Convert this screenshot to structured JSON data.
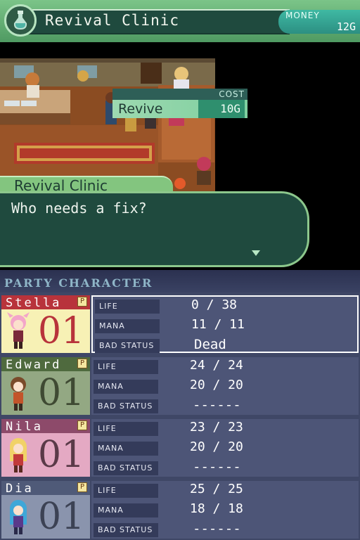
{
  "top": {
    "shop_title": "Revival Clinic",
    "money_label": "MONEY",
    "money_value": "12G",
    "cost_label": "COST",
    "service_name": "Revive",
    "service_cost": "10G",
    "dialog_speaker": "Revival Clinic",
    "dialog_text": "Who needs a fix?",
    "icon": "potion-bottle-icon"
  },
  "bottom": {
    "section_title": "PARTY CHARACTER",
    "stat_labels": {
      "life": "LIFE",
      "mana": "MANA",
      "bad_status": "BAD STATUS"
    },
    "characters": [
      {
        "name": "Stella",
        "badge": "P",
        "level": "01",
        "life": "0 / 38",
        "mana": "11 / 11",
        "bad_status": "Dead",
        "selected": true,
        "name_color": "#b8333b",
        "portrait_bg": "#f7f1b5",
        "level_color": "#b8333b"
      },
      {
        "name": "Edward",
        "badge": "P",
        "level": "01",
        "life": "24 / 24",
        "mana": "20 / 20",
        "bad_status": "------",
        "selected": false,
        "name_color": "#4f6a3e",
        "portrait_bg": "#93a883",
        "level_color": "#3f4a33"
      },
      {
        "name": "Nila",
        "badge": "P",
        "level": "01",
        "life": "23 / 23",
        "mana": "20 / 20",
        "bad_status": "------",
        "selected": false,
        "name_color": "#8d4a6a",
        "portrait_bg": "#e4a9c3",
        "level_color": "#5a3a48"
      },
      {
        "name": "Dia",
        "badge": "P",
        "level": "01",
        "life": "25 / 25",
        "mana": "18 / 18",
        "bad_status": "------",
        "selected": false,
        "name_color": "#4f5a78",
        "portrait_bg": "#8a94ad",
        "level_color": "#3c4254"
      }
    ]
  }
}
